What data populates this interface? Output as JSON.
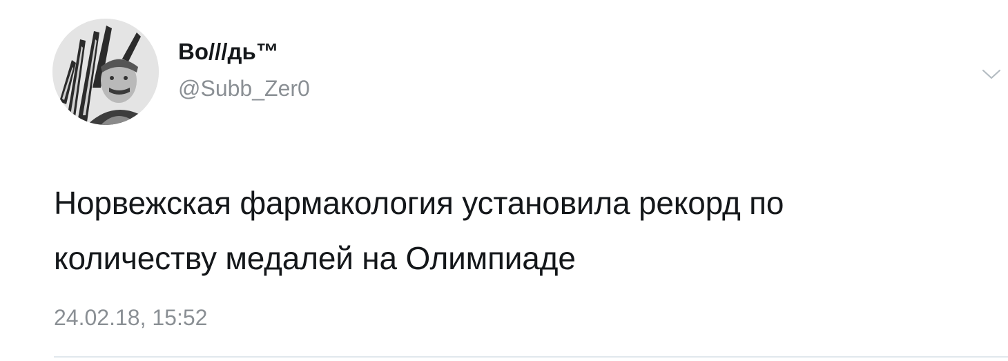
{
  "author": {
    "display_name": "Во///дь™",
    "handle": "@Subb_Zer0"
  },
  "tweet": {
    "text_lines": [
      "Норвежская фармакология установила рекорд по",
      "количеству медалей на Олимпиаде"
    ],
    "timestamp": "24.02.18, 15:52"
  },
  "icons": {
    "menu": "chevron-down-icon"
  },
  "colors": {
    "text": "#14171a",
    "secondary": "#8a8f94",
    "divider": "#e1e8ed",
    "background": "#ffffff"
  }
}
